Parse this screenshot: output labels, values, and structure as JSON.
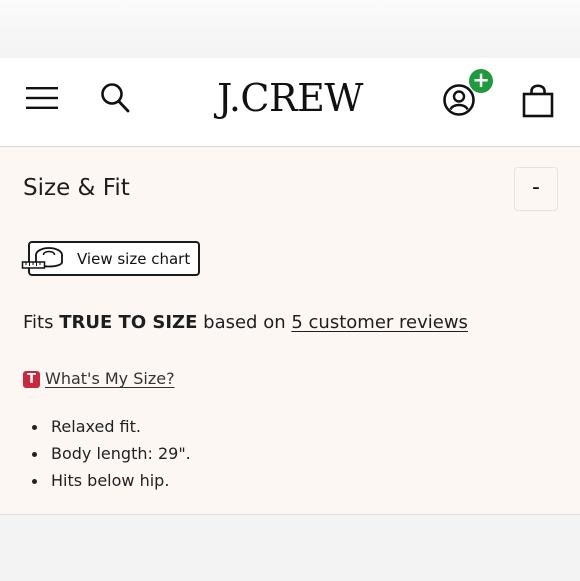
{
  "header": {
    "logo": "J.CREW",
    "account_badge": "+"
  },
  "section": {
    "title": "Size & Fit",
    "collapse_label": "-",
    "size_chart_label": "View size chart",
    "fit_prefix": "Fits",
    "fit_value": "TRUE TO SIZE",
    "fit_middle": "based on",
    "reviews_link": "5 customer reviews",
    "whats_my_size_badge": "T",
    "whats_my_size": "What's My Size?",
    "bullets": [
      "Relaxed fit.",
      "Body length: 29\".",
      "Hits below hip."
    ]
  },
  "icons": [
    "menu-icon",
    "search-icon",
    "account-icon",
    "bag-icon",
    "measuring-tape-icon"
  ],
  "colors": {
    "badge_green": "#1f9a3f",
    "badge_red": "#c8293f",
    "panel_bg": "#fdf7f4"
  }
}
